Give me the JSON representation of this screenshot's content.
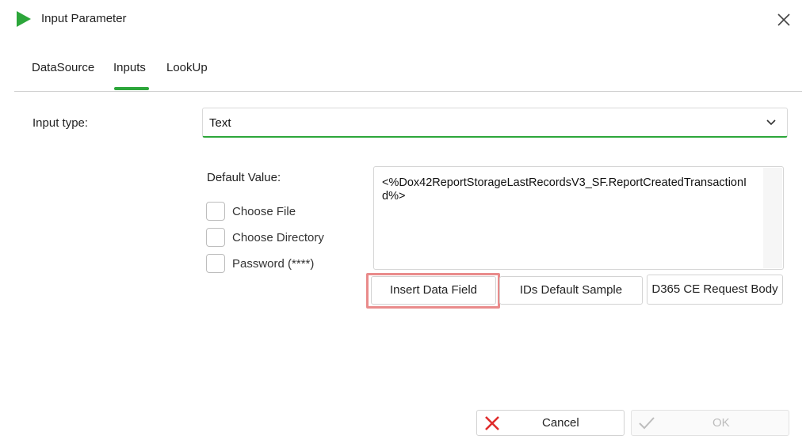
{
  "window": {
    "title": "Input Parameter",
    "icon": "play-triangle-icon",
    "accent_color": "#2ca63a"
  },
  "tabs": [
    {
      "label": "DataSource",
      "active": false
    },
    {
      "label": "Inputs",
      "active": true
    },
    {
      "label": "LookUp",
      "active": false
    }
  ],
  "form": {
    "input_type_label": "Input type:",
    "input_type_value": "Text",
    "default_value_label": "Default Value:",
    "default_value_text": "<%Dox42ReportStorageLastRecordsV3_SF.ReportCreatedTransactionId%>",
    "options": [
      {
        "label": "Choose File",
        "checked": false
      },
      {
        "label": "Choose Directory",
        "checked": false
      },
      {
        "label": "Password (****)",
        "checked": false
      }
    ]
  },
  "actions": {
    "insert_data_field": "Insert Data Field",
    "ids_default_sample": "IDs Default Sample",
    "d365_request_body": "D365 CE Request Body",
    "highlight_color": "#e98b8b"
  },
  "footer": {
    "cancel_label": "Cancel",
    "ok_label": "OK",
    "ok_enabled": false,
    "cancel_icon_color": "#e02b2b"
  }
}
